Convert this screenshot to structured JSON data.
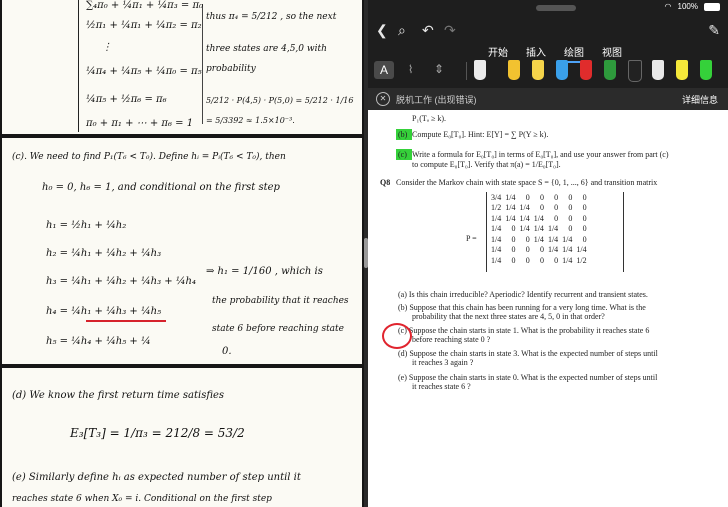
{
  "status": {
    "wifi": "wifi-icon",
    "battery_pct": "100%"
  },
  "toolbar_tabs": [
    "开始",
    "插入",
    "绘图",
    "视图"
  ],
  "active_tab": "绘图",
  "tool_letter": "A",
  "banner": {
    "text": "脱机工作 (出现错误)",
    "details": "详细信息"
  },
  "notes": {
    "c1": "∑₄π₀ + ¼π₁ + ¼π₃ = π₀",
    "c2": "½π₁ + ¼π₁ + ¼π₂ = π₂",
    "c3": "⋮",
    "c4": "¼π₄ + ¼π₅ + ¼π₀ = π₅",
    "c5": "¼π₅ + ½π₆ = π₆",
    "c6": "π₀ + π₁ + ⋯ + π₆ = 1",
    "r1": "thus π₄ = 5/212 , so the next",
    "r2": "three states are 4,5,0 with",
    "r3": "probability",
    "r4": "5/212 · P(4,5) · P(5,0) = 5/212 · 1/16",
    "r5": "= 5/3392 ≈ 1.5×10⁻³.",
    "p1": "(c). We need to find  P₁(T₆ < T₀).  Define hᵢ = Pᵢ(T₆ < T₀), then",
    "p2": "h₀ = 0,  h₆ = 1,  and conditional on the first step",
    "h1": "h₁ = ½h₁ + ¼h₂",
    "h2": "h₂ = ¼h₁ + ¼h₂ + ¼h₃",
    "h3": "h₃ = ¼h₁ + ¼h₂ + ¼h₃ + ¼h₄",
    "h4": "h₄ = ¼h₁ + ¼h₃ + ¼h₅",
    "h5": "h₅ = ¼h₄ + ¼h₅ + ¼",
    "res1": "⇒ h₁ = 1/160 , which is",
    "res2": "the probability that it reaches",
    "res3": "state 6 before reaching state",
    "res4": "0.",
    "d1": "(d) We know the first return time satisfies",
    "d2": "E₃[T₃] = 1/π₃ = 212/8 = 53/2",
    "e1": "(e) Similarly define hᵢ as expected number of step until it",
    "e2": "reaches state 6 when X₀ = i. Conditional on the first step"
  },
  "doc": {
    "a1": "P₁(Tₐ ≥ k).",
    "b_label": "(b)",
    "b_text": "Compute E₀[T₀].  Hint: E[Y] = ∑ P(Y ≥ k).",
    "c_label": "(c)",
    "c_text1": "Write a formula for E₀[T₀] in terms of E₀[T₀], and use your answer from part (c)",
    "c_text2": "to compute E₀[T₀].  Verify that π(a) = 1/E₀[T₀].",
    "q8": "Q8",
    "q8_text": "Consider the Markov chain with state space S = {0, 1, ..., 6} and transition matrix",
    "P": "P =",
    "matrix": [
      [
        "3/4",
        "1/4",
        "0",
        "0",
        "0",
        "0",
        "0"
      ],
      [
        "1/2",
        "1/4",
        "1/4",
        "0",
        "0",
        "0",
        "0"
      ],
      [
        "1/4",
        "1/4",
        "1/4",
        "1/4",
        "0",
        "0",
        "0"
      ],
      [
        "1/4",
        "0",
        "1/4",
        "1/4",
        "1/4",
        "0",
        "0"
      ],
      [
        "1/4",
        "0",
        "0",
        "1/4",
        "1/4",
        "1/4",
        "0"
      ],
      [
        "1/4",
        "0",
        "0",
        "0",
        "1/4",
        "1/4",
        "1/4"
      ],
      [
        "1/4",
        "0",
        "0",
        "0",
        "0",
        "1/4",
        "1/2"
      ]
    ],
    "qa": "(a) Is this chain irreducible? Aperiodic? Identify recurrent and transient states.",
    "qb1": "(b) Suppose that this chain has been running for a very long time.  What is the",
    "qb2": "probability that the next three states are 4, 5, 0 in that order?",
    "qc1": "(c) Suppose the chain starts in state 1.  What is the probability it reaches state 6",
    "qc2": "before reaching state 0 ?",
    "qd1": "(d) Suppose the chain starts in state 3.  What is the expected number of steps until",
    "qd2": "it reaches 3 again ?",
    "qe1": "(e) Suppose the chain starts in state 0.  What is the expected number of steps until",
    "qe2": "it reaches state 6 ?"
  },
  "colors": {
    "accent": "#4fa3f7",
    "highlight": "#35d13a",
    "annotation": "#e0242e"
  }
}
